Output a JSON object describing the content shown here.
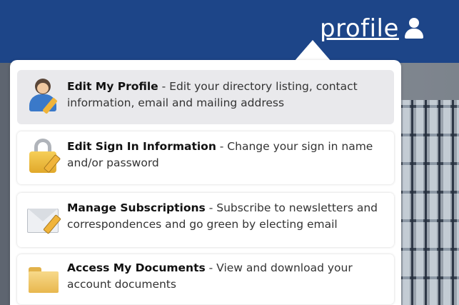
{
  "header": {
    "profile_label": "profile",
    "profile_icon": "person-icon",
    "background_color": "#1d4588"
  },
  "menu": {
    "items": [
      {
        "icon": "user-edit-icon",
        "title": "Edit My Profile",
        "description": " - Edit your directory listing, contact information, email and mailing address",
        "highlighted": true
      },
      {
        "icon": "lock-edit-icon",
        "title": "Edit Sign In Information",
        "description": " - Change your sign in name and/or password",
        "highlighted": false
      },
      {
        "icon": "envelope-edit-icon",
        "title": "Manage Subscriptions",
        "description": " - Subscribe to newsletters and correspondences and go green by electing email",
        "highlighted": false
      },
      {
        "icon": "folder-icon",
        "title": "Access My Documents",
        "description": " - View and download your account documents",
        "highlighted": false
      }
    ]
  }
}
